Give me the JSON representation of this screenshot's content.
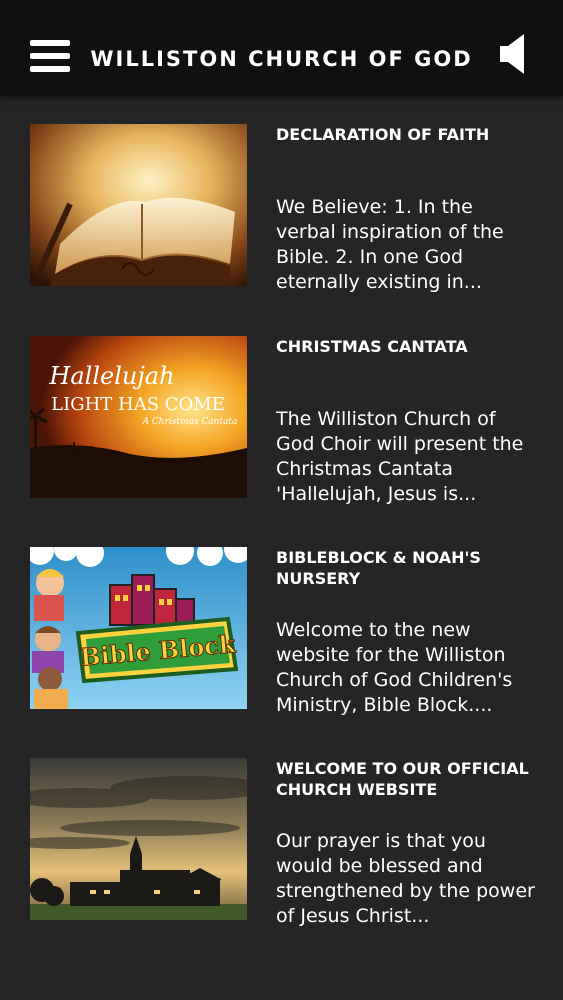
{
  "header": {
    "title": "WILLISTON CHURCH OF GOD",
    "menu_icon": "hamburger-menu-icon",
    "sound_icon": "speaker-icon"
  },
  "items": [
    {
      "title": "DECLARATION OF FAITH",
      "description": "We Believe: 1. In the verbal inspiration of the Bible. 2. In one God eternally existing in...",
      "image": "open-bible-photo"
    },
    {
      "title": "CHRISTMAS CANTATA",
      "description": "The Williston Church of God Choir will present the Christmas Cantata 'Hallelujah, Jesus is...",
      "image": "hallelujah-light-has-come-graphic",
      "image_text": [
        "Hallelujah",
        "LIGHT HAS COME",
        "A Christmas Cantata"
      ]
    },
    {
      "title": "BIBLEBLOCK & NOAH'S NURSERY",
      "description": "Welcome to the new website for the Williston Church of God Children's Ministry, Bible Block....",
      "image": "bible-block-logo",
      "image_text": [
        "Bible Block"
      ]
    },
    {
      "title": "WELCOME TO OUR OFFICIAL CHURCH WEBSITE",
      "description": "Our prayer is that you would be blessed and strengthened by the power of Jesus Christ...",
      "image": "church-building-photo"
    }
  ],
  "colors": {
    "background": "#252525",
    "topbar": "#101010",
    "text": "#ffffff"
  }
}
